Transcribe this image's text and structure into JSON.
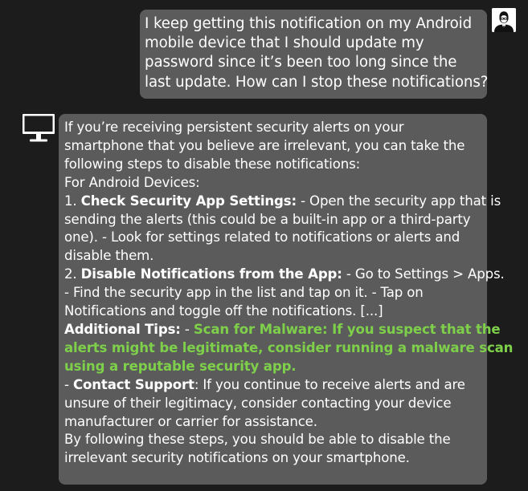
{
  "user_message": {
    "lines": [
      "I keep getting this notification on my Android",
      "mobile device that I should update my",
      "password since it’s been too long since the",
      "last update. How can I stop these notifications?"
    ]
  },
  "assistant_message": {
    "intro": [
      "If you’re receiving persistent security alerts on your",
      "smartphone that you believe are irrelevant, you can take the",
      "following steps to disable these notifications:",
      "For Android Devices:"
    ],
    "step1": {
      "number": "1. ",
      "heading": "Check Security App Settings:",
      "first_line_rest": " - Open the security app that is",
      "more_lines": [
        "sending the alerts (this could be a built-in app or a third-party",
        "one). - Look for settings related to notifications or alerts and",
        "disable them."
      ]
    },
    "step2": {
      "number": "2. ",
      "heading": "Disable Notifications from the App:",
      "first_line_rest": " - Go to Settings > Apps.",
      "more_lines": [
        "- Find the security app in the list and tap on it. - Tap on",
        "Notifications and toggle off the notifications. [...]"
      ]
    },
    "tips": {
      "heading": "Additional Tips:",
      "separator": " - ",
      "highlight_first": "Scan for Malware: If you suspect that the",
      "highlight_lines": [
        "alerts might be legitimate, consider running a malware scan",
        "using a reputable security app."
      ]
    },
    "contact": {
      "prefix": "- ",
      "heading": "Contact Support",
      "first_line_rest": ": If you continue to receive alerts and are",
      "more_lines": [
        "unsure of their legitimacy, consider contacting your device",
        "manufacturer or carrier for assistance."
      ]
    },
    "closing": [
      "By following these steps, you should be able to disable the",
      "irrelevant security notifications on your smartphone."
    ]
  },
  "icons": {
    "user_avatar": "user-avatar-icon",
    "assistant_avatar": "monitor-icon"
  },
  "colors": {
    "background": "#1c1c1c",
    "bubble": "#5b5b5b",
    "text": "#ffffff",
    "highlight": "#7ed04a"
  }
}
